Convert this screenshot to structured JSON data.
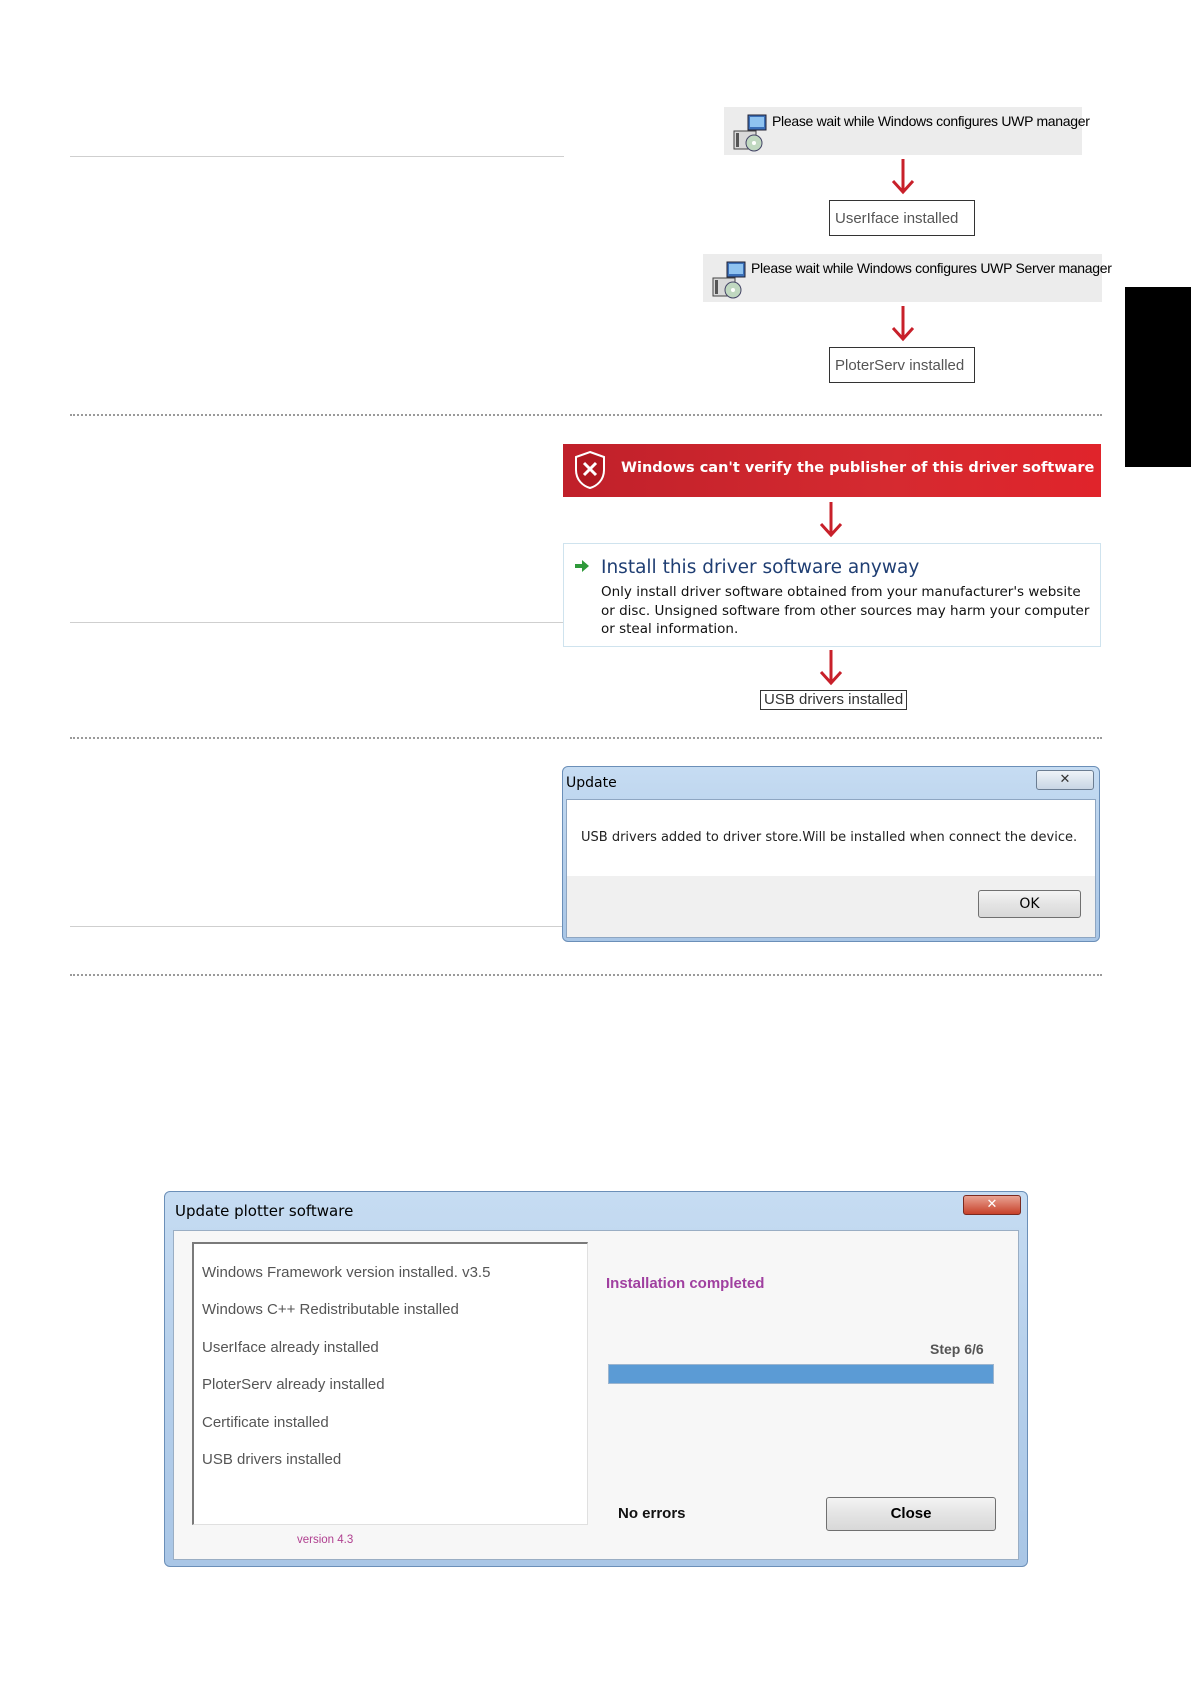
{
  "installer_steps": [
    {
      "message": "Please wait while Windows configures UWP manager",
      "result": "UserIface installed"
    },
    {
      "message": "Please wait while Windows configures UWP Server manager",
      "result": "PloterServ installed"
    }
  ],
  "driver_warning": {
    "banner": "Windows can't verify the publisher of this driver software",
    "option_title": "Install this driver software anyway",
    "option_body": "Only install driver software obtained from your manufacturer's website or disc. Unsigned software from other sources may harm your computer or steal information.",
    "result": "USB drivers installed"
  },
  "update_dialog": {
    "title": "Update",
    "close": "✕",
    "message": "USB drivers added to driver store.Will be installed when connect the device.",
    "ok": "OK"
  },
  "plotter_dialog": {
    "title": "Update plotter software",
    "close": "✕",
    "log": [
      "Windows Framework version installed. v3.5",
      "Windows C++ Redistributable installed",
      "UserIface already installed",
      "PloterServ already installed",
      "Certificate installed",
      "USB drivers installed"
    ],
    "version": "version 4.3",
    "status": "Installation completed",
    "step": "Step 6/6",
    "progress_fraction": 1.0,
    "errors": "No errors",
    "close_button": "Close"
  },
  "colors": {
    "arrow": "#c8202a",
    "status_text": "#a040a0",
    "progress_fill": "#5b9bd5"
  }
}
